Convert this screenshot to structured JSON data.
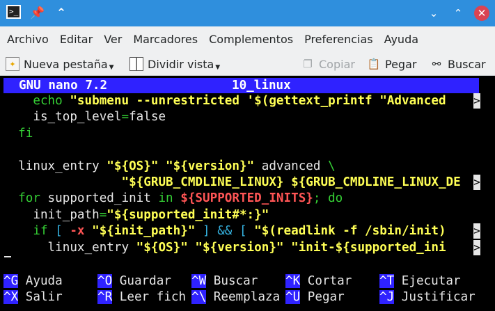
{
  "titlebar": {
    "icons": [
      "terminal-icon",
      "pin-icon",
      "keep-above-icon",
      "minimize-icon",
      "maximize-icon",
      "close-icon"
    ]
  },
  "menu": [
    "Archivo",
    "Editar",
    "Ver",
    "Marcadores",
    "Complementos",
    "Preferencias",
    "Ayuda"
  ],
  "toolbar": {
    "new_tab": "Nueva pestaña",
    "split_view": "Dividir vista",
    "copy": "Copiar",
    "paste": "Pegar",
    "search": "Buscar"
  },
  "nano": {
    "app": "GNU nano 7.2",
    "file": "10_linux",
    "lines": [
      [
        [
          "    ",
          "w"
        ],
        [
          "echo",
          "g"
        ],
        [
          " ",
          "w"
        ],
        [
          "\"submenu --unrestricted '$(gettext_printf \"Advanced",
          "y"
        ]
      ],
      [
        [
          "    is_top_level",
          "w"
        ],
        [
          "=",
          "g"
        ],
        [
          "false",
          "w"
        ]
      ],
      [
        [
          "  fi",
          "g"
        ]
      ],
      [
        [
          "",
          "w"
        ]
      ],
      [
        [
          "  linux_entry ",
          "w"
        ],
        [
          "\"${OS}\" \"${version}\"",
          "y"
        ],
        [
          " advanced ",
          "w"
        ],
        [
          "\\",
          "g"
        ]
      ],
      [
        [
          "                ",
          "w"
        ],
        [
          "\"${GRUB_CMDLINE_LINUX} ${GRUB_CMDLINE_LINUX_DE",
          "y"
        ]
      ],
      [
        [
          "  ",
          "w"
        ],
        [
          "for",
          "g"
        ],
        [
          " supported_init ",
          "w"
        ],
        [
          "in",
          "g"
        ],
        [
          " ",
          "w"
        ],
        [
          "${SUPPORTED_INITS}",
          "r"
        ],
        [
          "; do",
          "g"
        ]
      ],
      [
        [
          "    init_path",
          "w"
        ],
        [
          "=",
          "g"
        ],
        [
          "\"${supported_init#*:}\"",
          "y"
        ]
      ],
      [
        [
          "    ",
          "w"
        ],
        [
          "if",
          "g"
        ],
        [
          " [ ",
          "c"
        ],
        [
          "-x",
          "r"
        ],
        [
          " ",
          "w"
        ],
        [
          "\"${init_path}\"",
          "y"
        ],
        [
          " ] && [ ",
          "c"
        ],
        [
          "\"$(readlink -f /sbin/init)",
          "y"
        ]
      ],
      [
        [
          "      linux_entry ",
          "w"
        ],
        [
          "\"${OS}\" \"${version}\" \"init-${supported_ini",
          "y"
        ]
      ]
    ],
    "overflow_rows": [
      0,
      5,
      8,
      9
    ],
    "overflow_marker": ">",
    "shortcuts": [
      [
        {
          "key": "^G",
          "label": "Ayuda"
        },
        {
          "key": "^O",
          "label": "Guardar"
        },
        {
          "key": "^W",
          "label": "Buscar"
        },
        {
          "key": "^K",
          "label": "Cortar"
        },
        {
          "key": "^T",
          "label": "Ejecutar"
        }
      ],
      [
        {
          "key": "^X",
          "label": "Salir"
        },
        {
          "key": "^R",
          "label": "Leer fich"
        },
        {
          "key": "^\\",
          "label": "Reemplaza"
        },
        {
          "key": "^U",
          "label": "Pegar"
        },
        {
          "key": "^J",
          "label": "Justificar"
        }
      ]
    ]
  }
}
